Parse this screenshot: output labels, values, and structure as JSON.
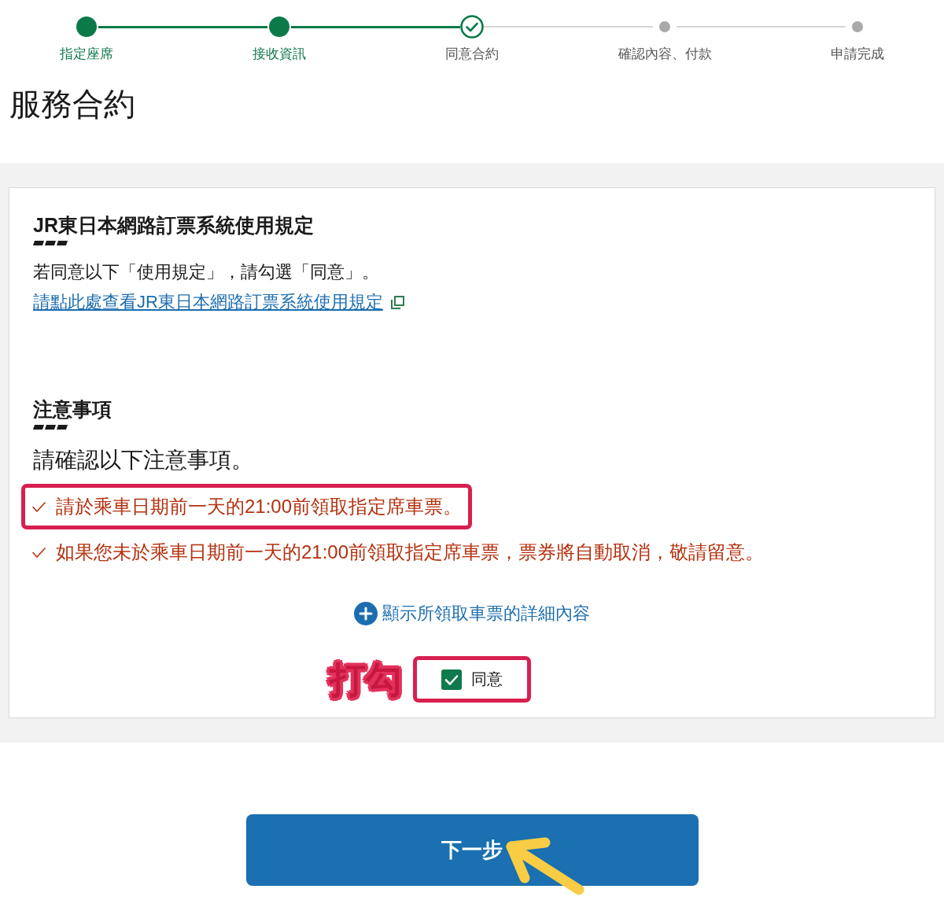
{
  "stepper": {
    "steps": [
      {
        "label": "指定座席",
        "completed": true,
        "current": false
      },
      {
        "label": "接收資訊",
        "completed": true,
        "current": false
      },
      {
        "label": "同意合約",
        "completed": false,
        "current": true
      },
      {
        "label": "確認內容、付款",
        "completed": false,
        "current": false
      },
      {
        "label": "申請完成",
        "completed": false,
        "current": false
      }
    ]
  },
  "page_title": "服務合約",
  "terms": {
    "heading": "JR東日本網路訂票系統使用規定",
    "text": "若同意以下「使用規定」，請勾選「同意」。",
    "link": "請點此處查看JR東日本網路訂票系統使用規定"
  },
  "notes": {
    "heading": "注意事項",
    "intro": "請確認以下注意事項。",
    "items": [
      {
        "text": "請於乘車日期前一天的21:00前領取指定席車票。",
        "highlighted": true
      },
      {
        "text": "如果您未於乘車日期前一天的21:00前領取指定席車票，票券將自動取消，敬請留意。",
        "highlighted": false
      }
    ]
  },
  "details_toggle": {
    "label": "顯示所領取車票的詳細內容"
  },
  "agree": {
    "label": "同意",
    "checked": true,
    "highlighted": true
  },
  "annotation": {
    "label": "打勾"
  },
  "next_button": {
    "label": "下一步"
  }
}
